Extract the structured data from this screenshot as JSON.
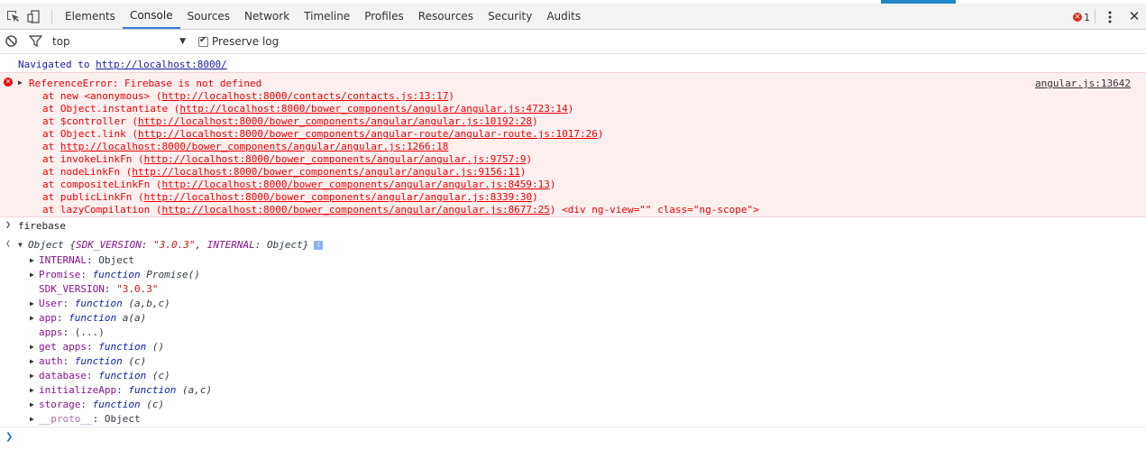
{
  "toolbar": {
    "tabs": [
      "Elements",
      "Console",
      "Sources",
      "Network",
      "Timeline",
      "Profiles",
      "Resources",
      "Security",
      "Audits"
    ],
    "error_count": "1",
    "accent_color": "#1e88c9"
  },
  "filter": {
    "context": "top",
    "preserve_log_label": "Preserve log"
  },
  "console": {
    "navigated_prefix": "Navigated to",
    "navigated_url": "http://localhost:8000/",
    "error": {
      "message": "ReferenceError: Firebase is not defined",
      "source": "angular.js:13642",
      "stack": [
        {
          "prefix": "at new <anonymous> (",
          "link": "http://localhost:8000/contacts/contacts.js:13:17",
          "suffix": ")"
        },
        {
          "prefix": "at Object.instantiate (",
          "link": "http://localhost:8000/bower_components/angular/angular.js:4723:14",
          "suffix": ")"
        },
        {
          "prefix": "at $controller (",
          "link": "http://localhost:8000/bower_components/angular/angular.js:10192:28",
          "suffix": ")"
        },
        {
          "prefix": "at Object.link (",
          "link": "http://localhost:8000/bower_components/angular-route/angular-route.js:1017:26",
          "suffix": ")"
        },
        {
          "prefix": "at ",
          "link": "http://localhost:8000/bower_components/angular/angular.js:1266:18",
          "suffix": ""
        },
        {
          "prefix": "at invokeLinkFn (",
          "link": "http://localhost:8000/bower_components/angular/angular.js:9757:9",
          "suffix": ")"
        },
        {
          "prefix": "at nodeLinkFn (",
          "link": "http://localhost:8000/bower_components/angular/angular.js:9156:11",
          "suffix": ")"
        },
        {
          "prefix": "at compositeLinkFn (",
          "link": "http://localhost:8000/bower_components/angular/angular.js:8459:13",
          "suffix": ")"
        },
        {
          "prefix": "at publicLinkFn (",
          "link": "http://localhost:8000/bower_components/angular/angular.js:8339:30",
          "suffix": ")"
        },
        {
          "prefix": "at lazyCompilation (",
          "link": "http://localhost:8000/bower_components/angular/angular.js:8677:25",
          "suffix": ") <div ng-view=\"\" class=\"ng-scope\">"
        }
      ]
    },
    "input_command": "firebase",
    "result_summary": {
      "label": "Object",
      "open": "{",
      "k1": "SDK_VERSION",
      "v1": "\"3.0.3\"",
      "k2": "INTERNAL",
      "v2": "Object",
      "close": "}",
      "info": "i"
    },
    "properties": [
      {
        "key": "INTERNAL",
        "sep": ": ",
        "kw": "",
        "val": "Object",
        "expandable": true
      },
      {
        "key": "Promise",
        "sep": ": ",
        "kw": "function",
        "val": "Promise()",
        "expandable": true
      },
      {
        "key": "SDK_VERSION",
        "sep": ": ",
        "kw": "",
        "val": "\"3.0.3\"",
        "expandable": false,
        "is_string": true
      },
      {
        "key": "User",
        "sep": ": ",
        "kw": "function",
        "val": "(a,b,c)",
        "expandable": true
      },
      {
        "key": "app",
        "sep": ": ",
        "kw": "function",
        "val": "a(a)",
        "expandable": true
      },
      {
        "key": "apps",
        "sep": ": ",
        "kw": "",
        "val": "(...)",
        "expandable": false
      },
      {
        "key": "get apps",
        "sep": ": ",
        "kw": "function",
        "val": "()",
        "expandable": true
      },
      {
        "key": "auth",
        "sep": ": ",
        "kw": "function",
        "val": "(c)",
        "expandable": true
      },
      {
        "key": "database",
        "sep": ": ",
        "kw": "function",
        "val": "(c)",
        "expandable": true
      },
      {
        "key": "initializeApp",
        "sep": ": ",
        "kw": "function",
        "val": "(a,c)",
        "expandable": true
      },
      {
        "key": "storage",
        "sep": ": ",
        "kw": "function",
        "val": "(c)",
        "expandable": true
      },
      {
        "key": "__proto__",
        "sep": ": ",
        "kw": "",
        "val": "Object",
        "expandable": true
      }
    ]
  }
}
